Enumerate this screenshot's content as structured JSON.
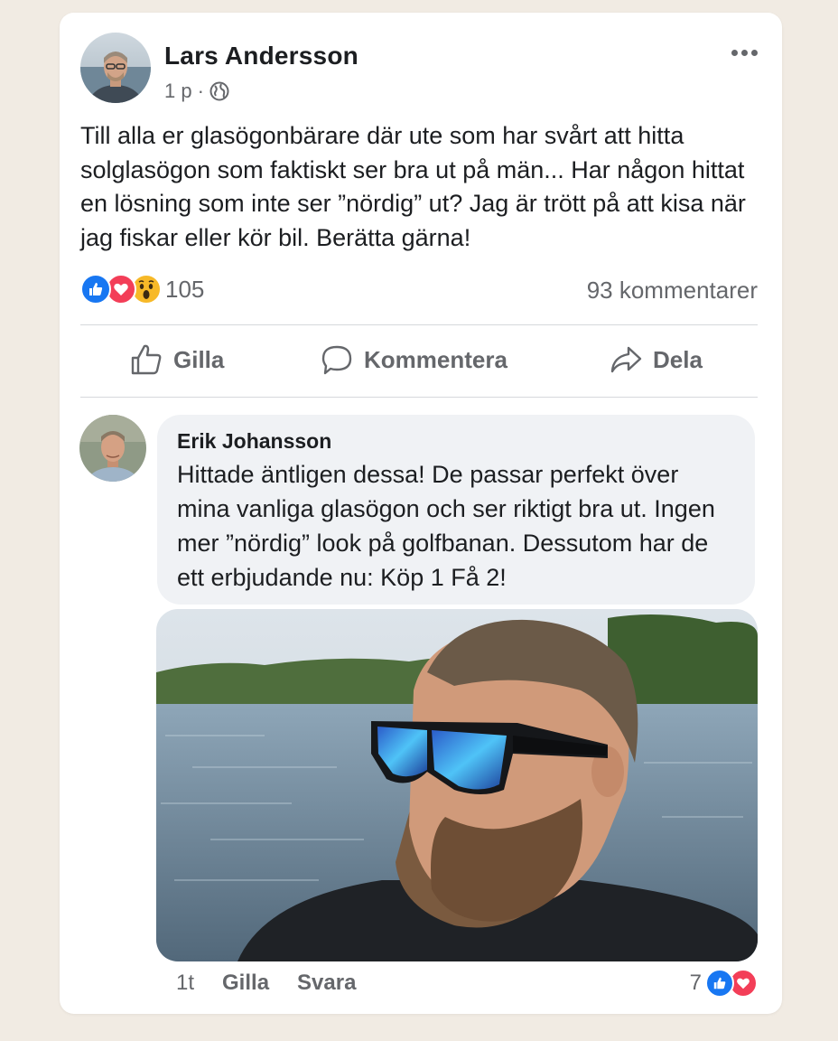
{
  "post": {
    "author": "Lars Andersson",
    "time": "1 p",
    "separator": "·",
    "text": "Till alla er glasögonbärare där ute som har svårt att hitta solglasögon som faktiskt ser bra ut på män... Har någon hittat en lösning som inte ser ”nördig” ut? Jag är trött på att kisa när jag fiskar eller kör bil. Berätta gärna!",
    "reaction_count": "105",
    "comment_count": "93 kommentarer",
    "reaction_icons": [
      "like-icon",
      "love-icon",
      "wow-icon"
    ]
  },
  "actions": {
    "like": "Gilla",
    "comment": "Kommentera",
    "share": "Dela"
  },
  "comment": {
    "author": "Erik Johansson",
    "text": "Hittade äntligen dessa! De passar perfekt över mina vanliga glasögon och ser riktigt bra ut. Ingen mer ”nördig” look på golfbanan. Dessutom har de ett erbjudande nu: Köp 1 Få 2!",
    "time": "1t",
    "like": "Gilla",
    "reply": "Svara",
    "reaction_count": "7",
    "reaction_icons": [
      "like-icon",
      "love-icon"
    ]
  },
  "colors": {
    "accent": "#1877f2",
    "love": "#f33e58",
    "wow": "#f7b928",
    "muted_text": "#65676b",
    "bubble": "#f0f2f5",
    "page_bg": "#f1ebe3"
  }
}
